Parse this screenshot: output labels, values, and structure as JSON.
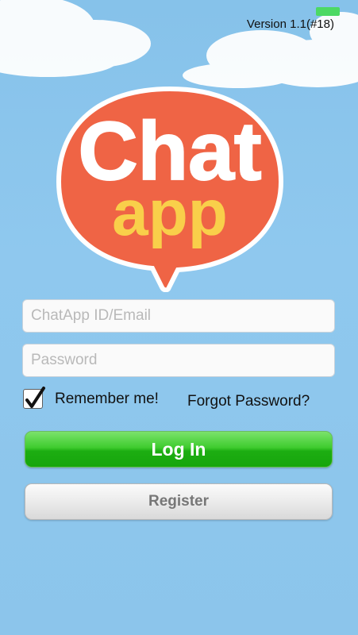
{
  "status_bar": {
    "battery_color": "#4cd964"
  },
  "app": {
    "version": "Version 1.1(#18)",
    "logo": {
      "line1": "Chat",
      "line2": "app",
      "bubble_color": "#ef6445",
      "accent_color": "#f9cf4a"
    }
  },
  "login_form": {
    "id_placeholder": "ChatApp ID/Email",
    "password_placeholder": "Password",
    "remember_label": "Remember me!",
    "remember_checked": true,
    "forgot_label": "Forgot Password?",
    "login_label": "Log In",
    "register_label": "Register"
  },
  "colors": {
    "sky": "#8ec6ec",
    "login_green": "#2fbf22",
    "register_gray": "#e6e6e6"
  }
}
